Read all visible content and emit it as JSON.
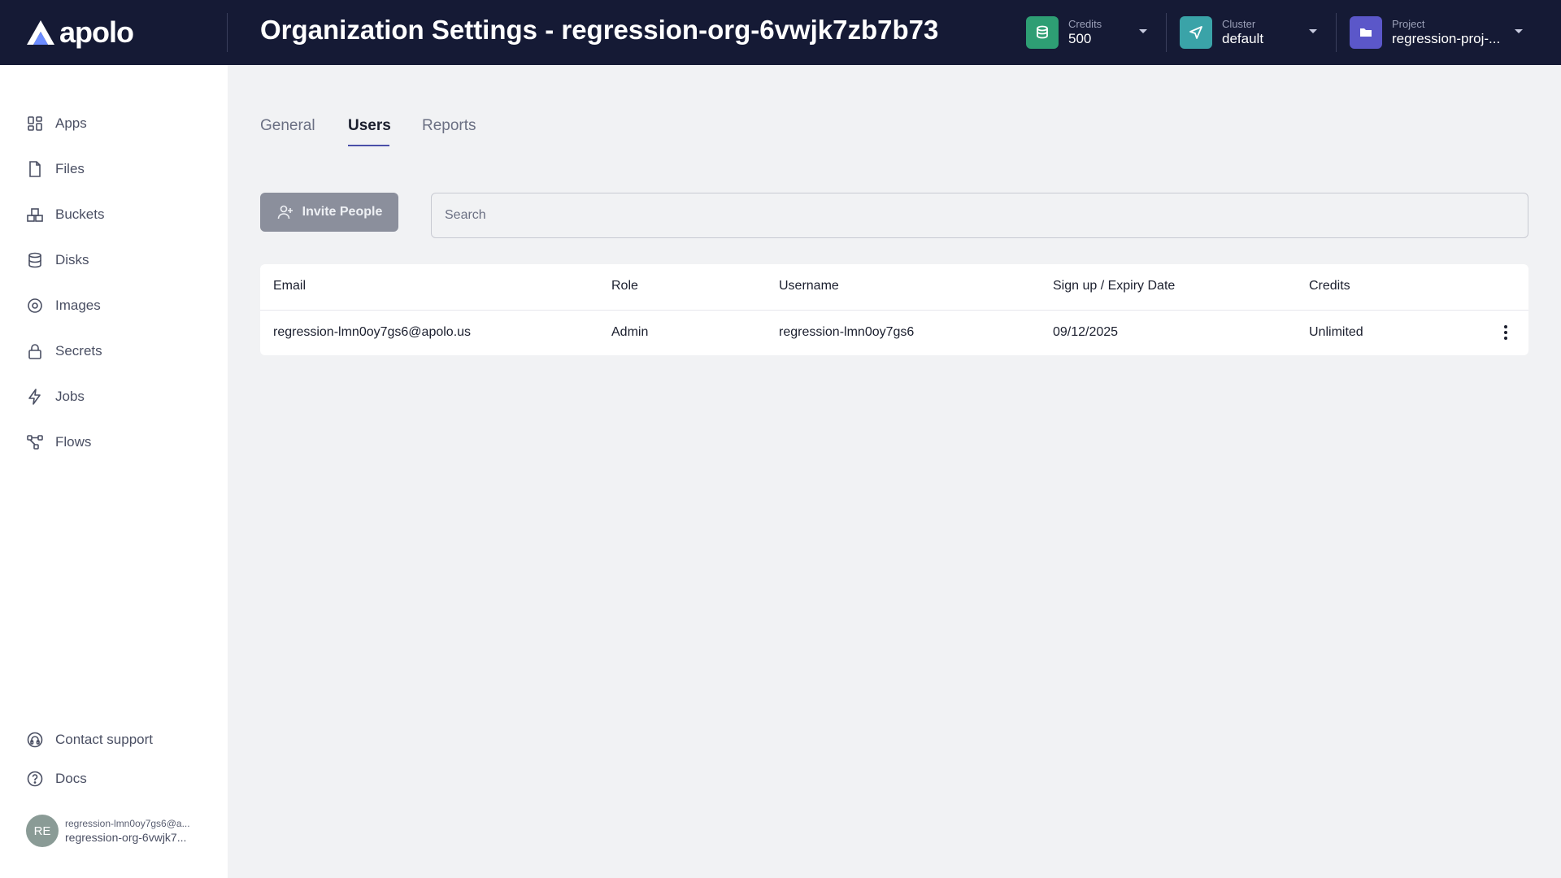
{
  "header": {
    "logo_text": "apolo",
    "title": "Organization Settings - regression-org-6vwjk7zb7b73",
    "credits": {
      "label": "Credits",
      "value": "500",
      "icon": "coins-icon",
      "color": "#2e9e74"
    },
    "cluster": {
      "label": "Cluster",
      "value": "default",
      "icon": "send-icon",
      "color": "#3aa3a8"
    },
    "project": {
      "label": "Project",
      "value": "regression-proj-...",
      "icon": "folder-icon",
      "color": "#5b57c9"
    }
  },
  "sidebar": {
    "items": [
      {
        "label": "Apps",
        "icon": "grid-icon"
      },
      {
        "label": "Files",
        "icon": "file-icon"
      },
      {
        "label": "Buckets",
        "icon": "boxes-icon"
      },
      {
        "label": "Disks",
        "icon": "database-icon"
      },
      {
        "label": "Images",
        "icon": "disc-icon"
      },
      {
        "label": "Secrets",
        "icon": "lock-icon"
      },
      {
        "label": "Jobs",
        "icon": "lightning-icon"
      },
      {
        "label": "Flows",
        "icon": "flow-icon"
      }
    ],
    "footer": [
      {
        "label": "Contact support",
        "icon": "headset-icon"
      },
      {
        "label": "Docs",
        "icon": "help-icon"
      }
    ],
    "user": {
      "initials": "RE",
      "email": "regression-lmn0oy7gs6@a...",
      "org": "regression-org-6vwjk7..."
    }
  },
  "tabs": [
    {
      "label": "General",
      "active": false
    },
    {
      "label": "Users",
      "active": true
    },
    {
      "label": "Reports",
      "active": false
    }
  ],
  "toolbar": {
    "invite_label": "Invite People",
    "search_placeholder": "Search",
    "search_value": ""
  },
  "table": {
    "columns": [
      "Email",
      "Role",
      "Username",
      "Sign up / Expiry Date",
      "Credits"
    ],
    "rows": [
      [
        "regression-lmn0oy7gs6@apolo.us",
        "Admin",
        "regression-lmn0oy7gs6",
        "09/12/2025",
        "Unlimited"
      ]
    ]
  },
  "colors": {
    "header_bg": "#151a35",
    "accent": "#4a4fa8",
    "logo_accent": "#6c8cff",
    "button_disabled": "#8b8f9c"
  }
}
